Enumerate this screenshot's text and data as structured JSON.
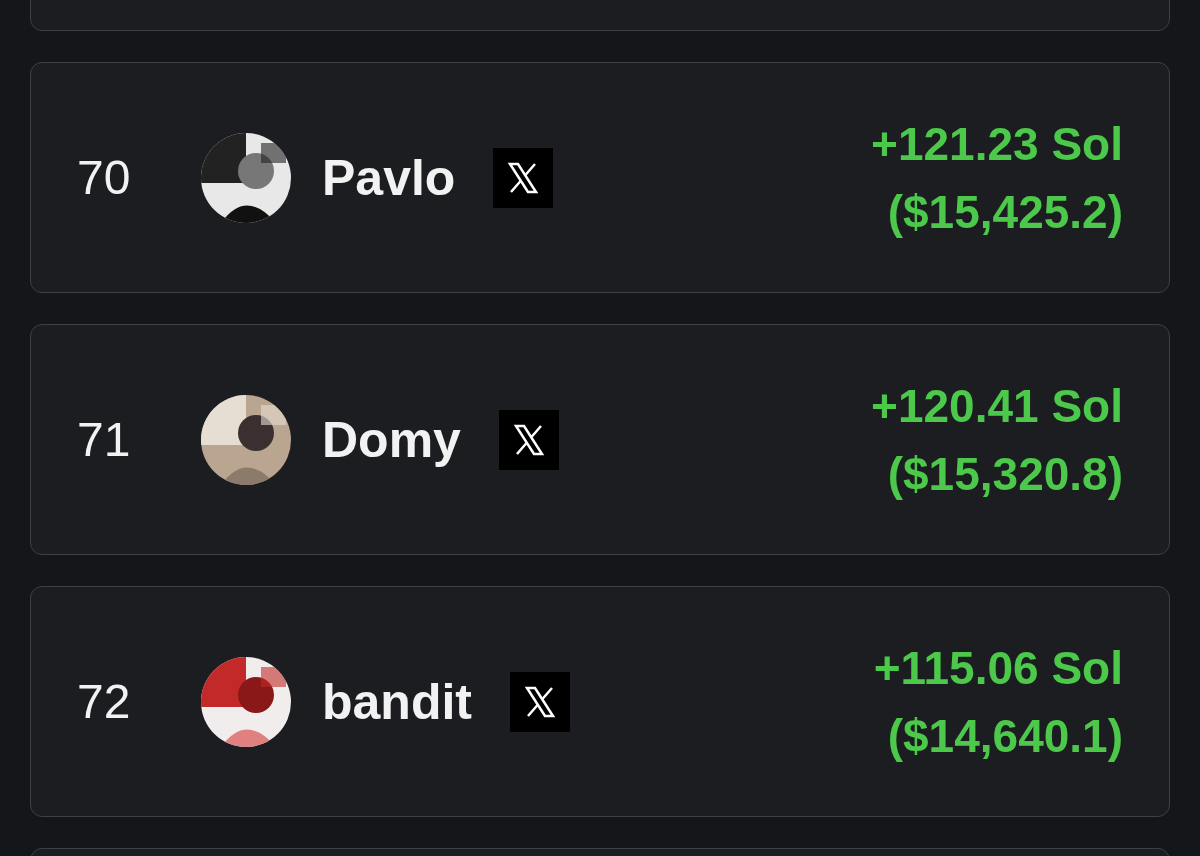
{
  "leaderboard": [
    {
      "rank": "70",
      "name": "Pavlo",
      "profit_sol": "+121.23 Sol",
      "profit_usd": "($15,425.2)"
    },
    {
      "rank": "71",
      "name": "Domy",
      "profit_sol": "+120.41 Sol",
      "profit_usd": "($15,320.8)"
    },
    {
      "rank": "72",
      "name": "bandit",
      "profit_sol": "+115.06 Sol",
      "profit_usd": "($14,640.1)"
    }
  ]
}
